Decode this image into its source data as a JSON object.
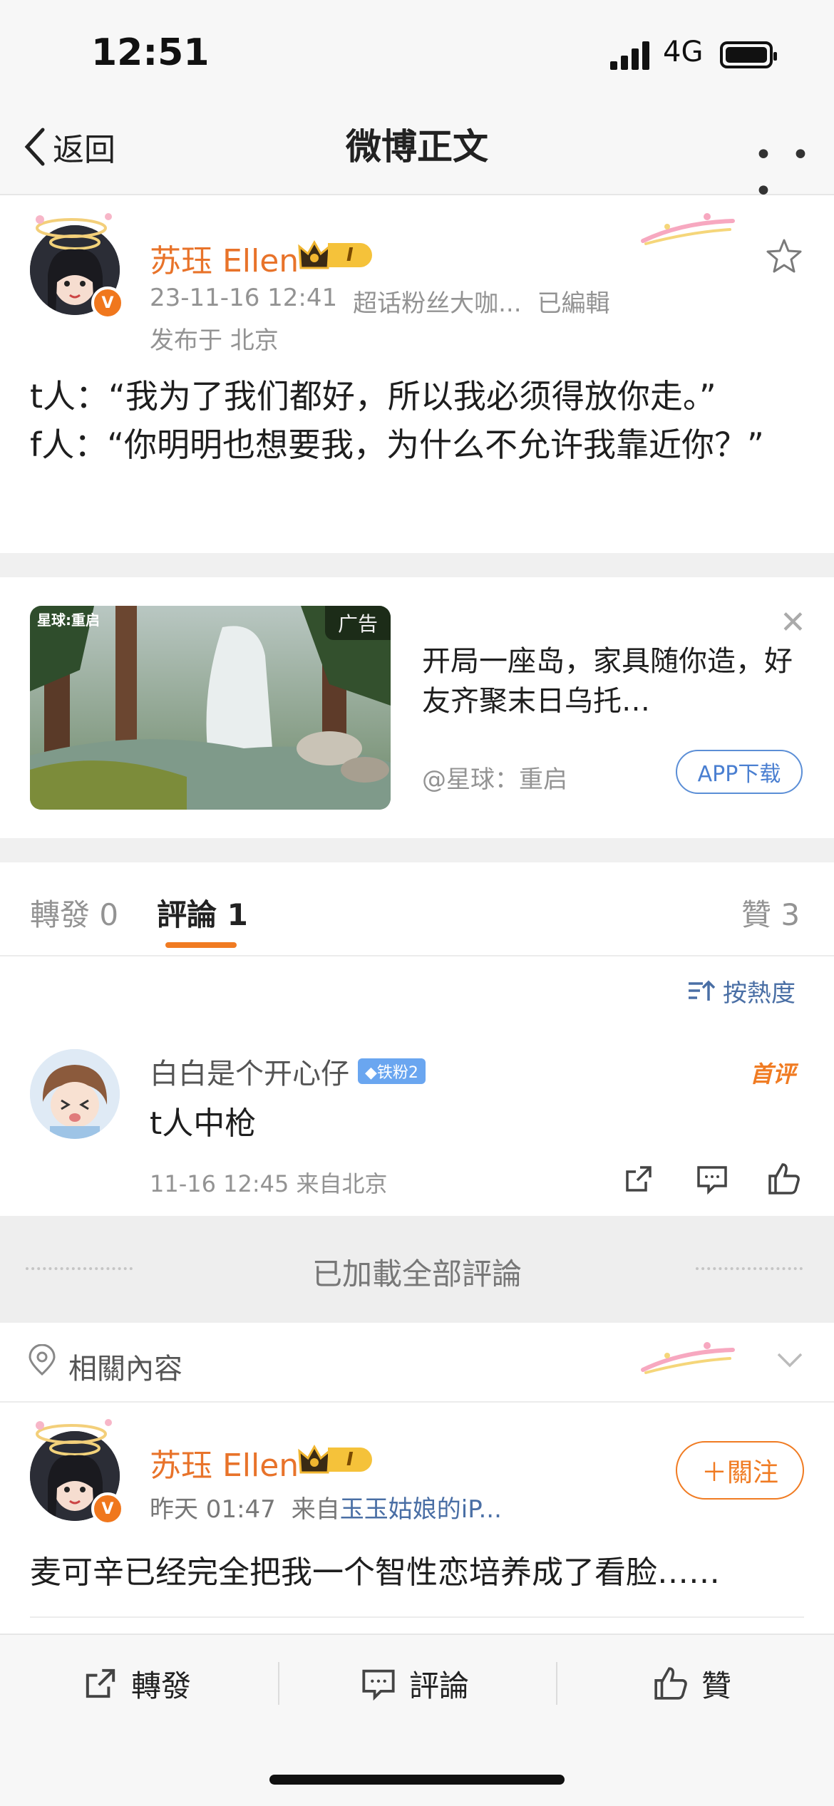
{
  "status": {
    "time": "12:51",
    "network": "4G"
  },
  "nav": {
    "back_label": "返回",
    "title": "微博正文"
  },
  "post": {
    "username": "苏珏 Ellen",
    "level_badge": "I",
    "timestamp": "23-11-16 12:41",
    "source": "超话粉丝大咖...",
    "edited": "已編輯",
    "location": "发布于 北京",
    "text": "t人：“我为了我们都好，所以我必须得放你走。”\nf人：“你明明也想要我，为什么不允许我靠近你？”"
  },
  "ad": {
    "tag": "广告",
    "image_logo": "星球:重启",
    "text": "开局一座岛，家具随你造，好友齐聚末日乌托…",
    "source": "@星球：重启",
    "button": "APP下载"
  },
  "tabs": {
    "repost": "轉發 0",
    "comments": "評論 1",
    "likes": "贊 3"
  },
  "sort_label": "按熱度",
  "comment": {
    "username": "白白是个开心仔",
    "fan_badge": "铁粉2",
    "first_tag": "首评",
    "text": "t人中枪",
    "meta": "11-16 12:45  来自北京"
  },
  "loaded_text": "已加載全部評論",
  "related": {
    "label": "相關內容",
    "username": "苏珏 Ellen",
    "level_badge": "I",
    "time": "昨天 01:47",
    "source_prefix": "来自",
    "source_link": "玉玉姑娘的iP...",
    "follow_label": "＋關注",
    "text": "麦可辛已经完全把我一个智性恋培养成了看脸……"
  },
  "bottom": {
    "repost": "轉發",
    "comment": "評論",
    "like": "贊"
  },
  "colors": {
    "accent": "#f07b22",
    "username": "#e8732a",
    "link": "#4a6fa5"
  }
}
